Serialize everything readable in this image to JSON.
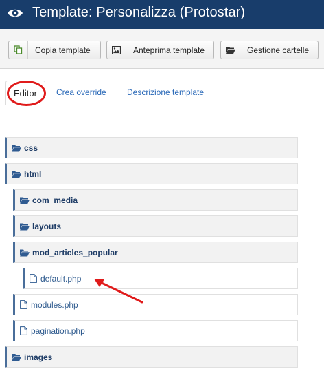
{
  "header": {
    "title": "Template: Personalizza (Protostar)",
    "icon": "eye-icon"
  },
  "toolbar": {
    "buttons": [
      {
        "label": "Copia template",
        "icon": "copy-icon"
      },
      {
        "label": "Anteprima template",
        "icon": "image-icon"
      },
      {
        "label": "Gestione cartelle",
        "icon": "folder-icon"
      }
    ]
  },
  "tabs": [
    {
      "label": "Editor",
      "active": true
    },
    {
      "label": "Crea override",
      "active": false
    },
    {
      "label": "Descrizione template",
      "active": false
    }
  ],
  "tree": {
    "css": "css",
    "html": "html",
    "com_media": "com_media",
    "layouts": "layouts",
    "mod_articles_popular": "mod_articles_popular",
    "default_php": "default.php",
    "modules_php": "modules.php",
    "pagination_php": "pagination.php",
    "images": "images"
  },
  "colors": {
    "header_bg": "#183d6b",
    "link": "#2a69b8",
    "annotation": "#e01b1b"
  }
}
